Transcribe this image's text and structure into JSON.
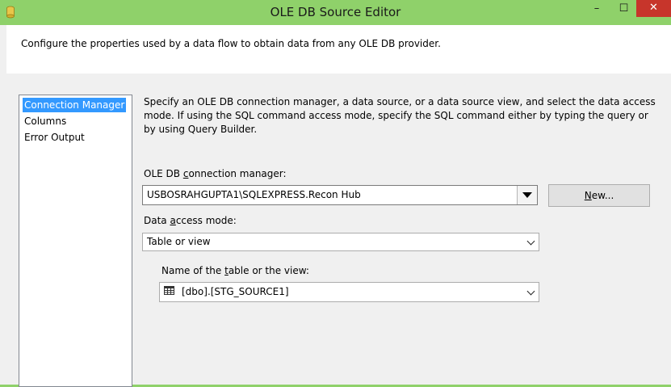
{
  "window": {
    "title": "OLE DB Source Editor",
    "minimize_glyph": "–",
    "maximize_glyph": "☐",
    "close_glyph": "✕"
  },
  "header": {
    "text": "Configure the properties used by a data flow to obtain data from any OLE DB provider."
  },
  "nav": {
    "items": [
      {
        "label": "Connection Manager",
        "selected": true
      },
      {
        "label": "Columns",
        "selected": false
      },
      {
        "label": "Error Output",
        "selected": false
      }
    ]
  },
  "main": {
    "description": "Specify an OLE DB connection manager, a data source, or a data source view, and select the data access mode. If using the SQL command access mode, specify the SQL command either by typing the query or by using Query Builder.",
    "connection_label_pre": "OLE DB ",
    "connection_label_key": "c",
    "connection_label_post": "onnection manager:",
    "connection_value": "USBOSRAHGUPTA1\\SQLEXPRESS.Recon Hub",
    "new_button_key": "N",
    "new_button_rest": "ew...",
    "access_mode_label_pre": "Data ",
    "access_mode_label_key": "a",
    "access_mode_label_post": "ccess mode:",
    "access_mode_value": "Table or view",
    "table_label_pre": "Name of the ",
    "table_label_key": "t",
    "table_label_post": "able or the view:",
    "table_value": "[dbo].[STG_SOURCE1]"
  },
  "colors": {
    "titlebar": "#8fd16a",
    "close_button": "#c7352b",
    "selection": "#3399ff"
  }
}
